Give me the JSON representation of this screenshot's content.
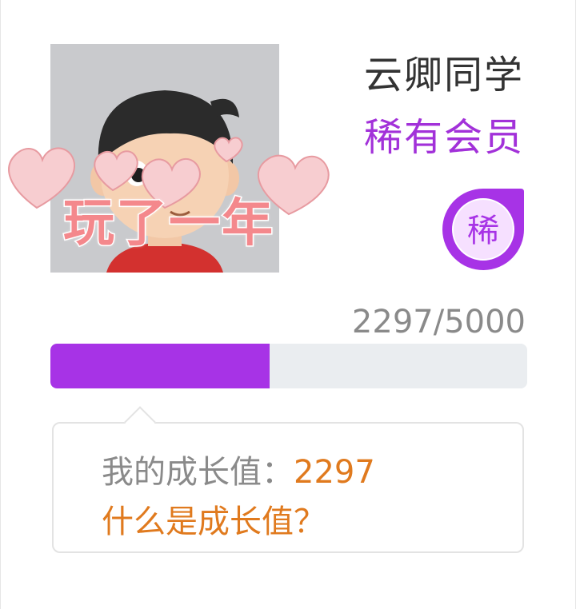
{
  "profile": {
    "username": "云卿同学",
    "member_tier": "稀有会员",
    "badge_char": "稀",
    "avatar_sticker_text": "玩了一年"
  },
  "progress": {
    "text": "2297/5000",
    "current": 2297,
    "max": 5000
  },
  "growth": {
    "label": "我的成长值：",
    "value": "2297",
    "link_text": "什么是成长值？"
  },
  "colors": {
    "accent_purple": "#a733e6",
    "tier_text": "#a231d9",
    "value_orange": "#e07a1e",
    "sticker_pink": "#f4888c"
  }
}
